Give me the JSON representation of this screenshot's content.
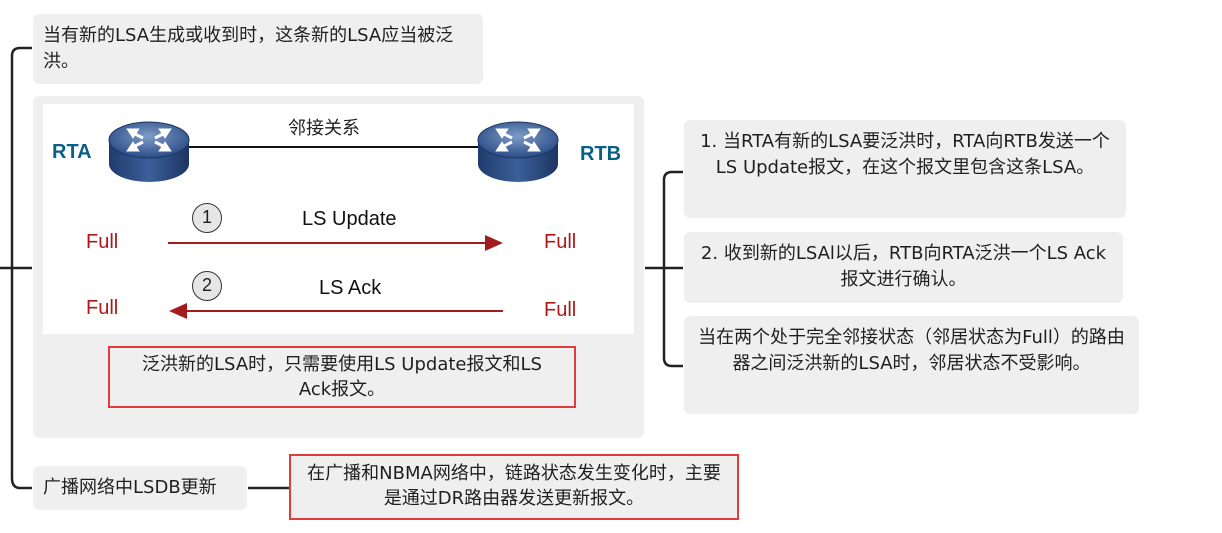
{
  "top_note": "当有新的LSA生成或收到时，这条新的LSA应当被泛洪。",
  "diagram": {
    "relation_label": "邻接关系",
    "router_a": "RTA",
    "router_b": "RTB",
    "step1": {
      "num": "1",
      "label": "LS Update",
      "left_state": "Full",
      "right_state": "Full"
    },
    "step2": {
      "num": "2",
      "label": "LS Ack",
      "left_state": "Full",
      "right_state": "Full"
    },
    "summary": "泛洪新的LSA时，只需要使用LS Update报文和LS Ack报文。"
  },
  "right_notes": [
    "1. 当RTA有新的LSA要泛洪时，RTA向RTB发送一个LS Update报文，在这个报文里包含这条LSA。",
    "2. 收到新的LSAl以后，RTB向RTA泛洪一个LS Ack报文进行确认。",
    "当在两个处于完全邻接状态（邻居状态为Full）的路由器之间泛洪新的LSA时，邻居状态不受影响。"
  ],
  "bottom": {
    "label": "广播网络中LSDB更新",
    "note": "在广播和NBMA网络中，链路状态发生变化时，主要是通过DR路由器发送更新报文。"
  },
  "colors": {
    "state": "#b01717",
    "router_name": "#0a5f86",
    "highlight_border": "#e03c3c",
    "node_bg": "#efefef"
  }
}
